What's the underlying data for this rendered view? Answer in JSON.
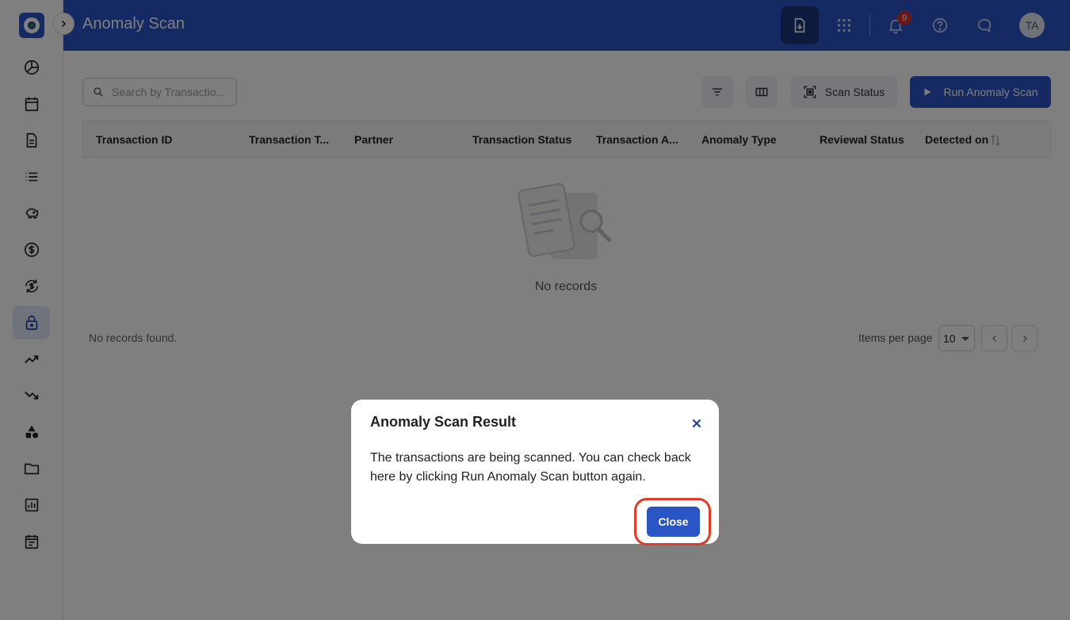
{
  "header": {
    "title": "Anomaly Scan",
    "notification_count": "9",
    "avatar_initials": "TA"
  },
  "sidebar": {
    "items": [
      {
        "icon": "pie-chart-icon"
      },
      {
        "icon": "calendar-icon"
      },
      {
        "icon": "document-icon"
      },
      {
        "icon": "list-icon"
      },
      {
        "icon": "piggy-bank-icon"
      },
      {
        "icon": "dollar-icon"
      },
      {
        "icon": "currency-exchange-icon"
      },
      {
        "icon": "lock-icon",
        "active": true
      },
      {
        "icon": "trending-up-icon"
      },
      {
        "icon": "trending-down-icon"
      },
      {
        "icon": "shapes-icon"
      },
      {
        "icon": "folder-icon"
      },
      {
        "icon": "bar-chart-icon"
      },
      {
        "icon": "event-note-icon"
      }
    ]
  },
  "toolbar": {
    "search_placeholder": "Search by Transactio...",
    "scan_status_label": "Scan Status",
    "run_scan_label": "Run Anomaly Scan"
  },
  "table": {
    "columns": [
      "Transaction ID",
      "Transaction T...",
      "Partner",
      "Transaction Status",
      "Transaction A...",
      "Anomaly Type",
      "Reviewal Status",
      "Detected on"
    ],
    "empty_text": "No records",
    "records_found": "No records found.",
    "items_per_page_label": "Items per page",
    "items_per_page_value": "10"
  },
  "modal": {
    "title": "Anomaly Scan Result",
    "body": "The transactions are being scanned. You can check back here by clicking Run Anomaly Scan button again.",
    "close_label": "Close"
  },
  "colors": {
    "brand": "#2a55c4",
    "highlight": "#e53a24"
  }
}
